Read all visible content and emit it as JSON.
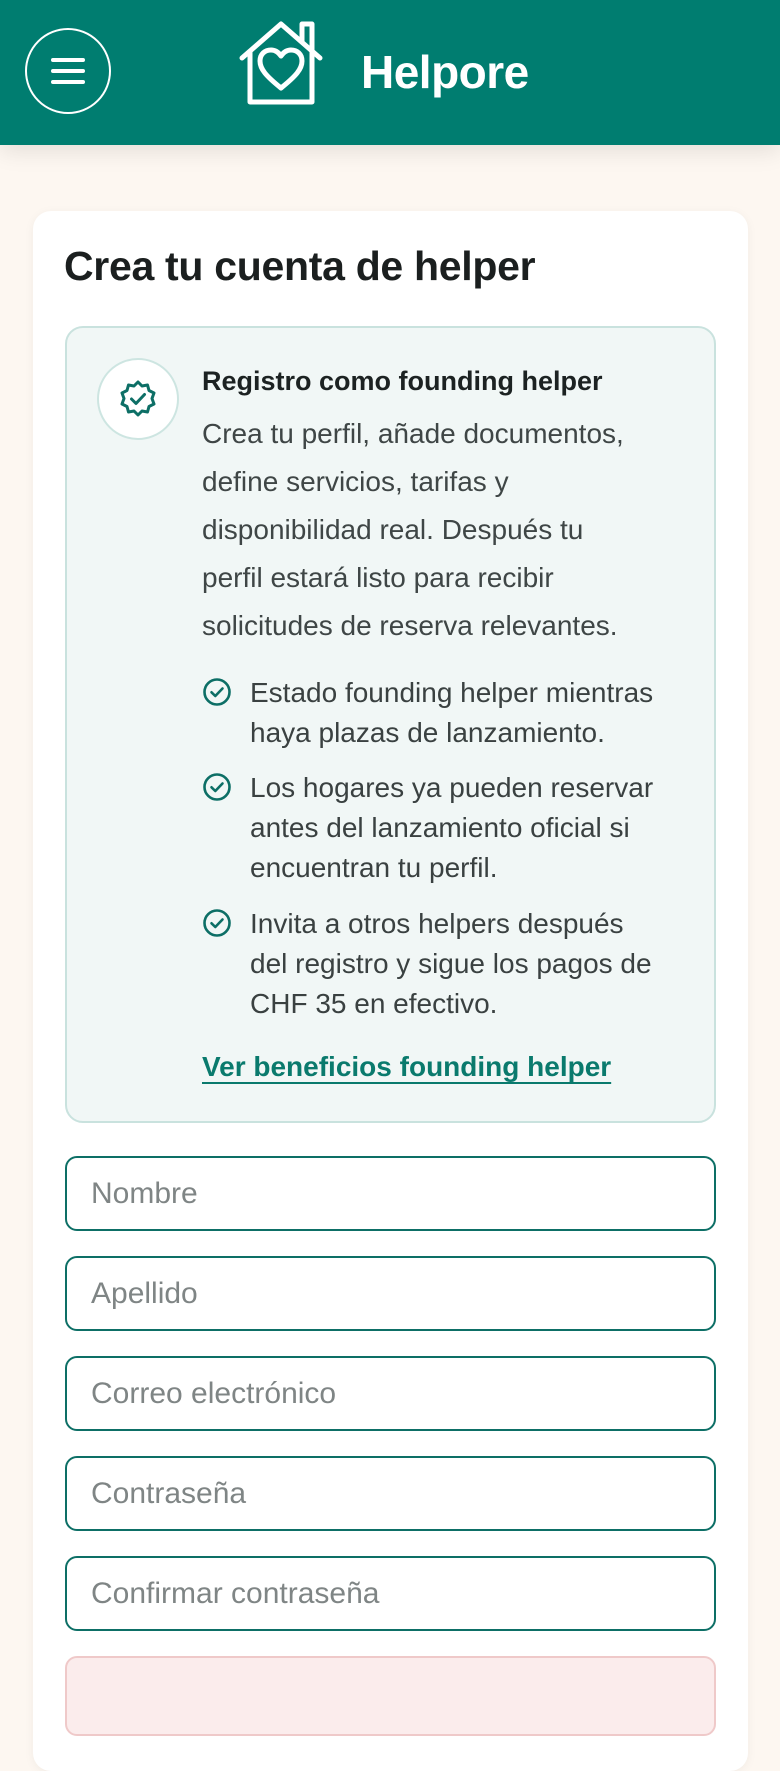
{
  "header": {
    "brand": "Helpore",
    "menu_icon": "hamburger-menu-icon",
    "logo_icon": "house-heart-icon",
    "bg_color": "#007d70"
  },
  "page": {
    "title": "Crea tu cuenta de helper"
  },
  "info_box": {
    "icon": "verified-badge-icon",
    "heading": "Registro como founding helper",
    "body_lines": [
      "Crea tu perfil, añade documentos,",
      "define servicios, tarifas y",
      "disponibilidad real. Después tu",
      "perfil estará listo para recibir",
      "solicitudes de reserva relevantes."
    ],
    "benefits": [
      {
        "icon": "check-circle-icon",
        "lines": [
          "Estado founding helper mientras",
          "haya plazas de lanzamiento."
        ]
      },
      {
        "icon": "check-circle-icon",
        "lines": [
          "Los hogares ya pueden reservar",
          "antes del lanzamiento oficial si",
          "encuentran tu perfil."
        ]
      },
      {
        "icon": "check-circle-icon",
        "lines": [
          "Invita a otros helpers después",
          "del registro y sigue los pagos de",
          "CHF 35 en efectivo."
        ]
      }
    ],
    "link_label": "Ver beneficios founding helper"
  },
  "form": {
    "first_name": {
      "placeholder": "Nombre",
      "value": ""
    },
    "last_name": {
      "placeholder": "Apellido",
      "value": ""
    },
    "email": {
      "placeholder": "Correo electrónico",
      "value": ""
    },
    "password": {
      "placeholder": "Contraseña",
      "value": ""
    },
    "confirm_password": {
      "placeholder": "Confirmar contraseña",
      "value": ""
    }
  },
  "alert": {
    "text": ""
  },
  "colors": {
    "primary": "#007d70",
    "accent_text": "#0a7a6d",
    "page_bg": "#fdf7f1",
    "info_bg": "#f1f7f6",
    "alert_bg": "#fbecec"
  }
}
